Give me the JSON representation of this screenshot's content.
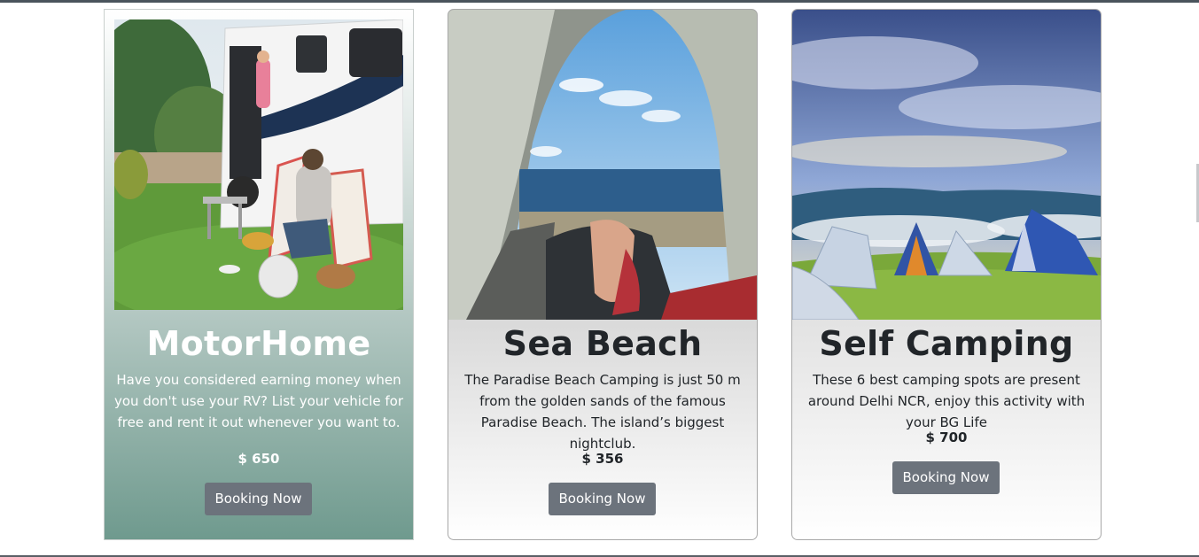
{
  "cards": [
    {
      "title": "MotorHome",
      "description": "Have you considered earning money when you don't use your RV? List your vehicle for free and rent it out whenever you want to.",
      "price": "$ 650",
      "button_label": "Booking Now",
      "image_alt": "Couple relaxing beside a motorhome on a lawn"
    },
    {
      "title": "Sea Beach",
      "description": "The Paradise Beach Camping is just 50 m from the golden sands of the famous Paradise Beach. The island’s biggest nightclub.",
      "price": "$ 356",
      "button_label": "Booking Now",
      "image_alt": "View of the sea from inside a tent"
    },
    {
      "title": "Self Camping",
      "description": "These 6 best camping spots are present around Delhi NCR, enjoy this activity with your BG Life",
      "price": "$ 700",
      "button_label": "Booking Now",
      "image_alt": "Tents on a grassy hill under a cloudy sky"
    }
  ],
  "colors": {
    "button": "#6c737c",
    "card1_gradient_bottom": "#6f9a8e",
    "card2_gradient_top": "#c9c9c9"
  }
}
